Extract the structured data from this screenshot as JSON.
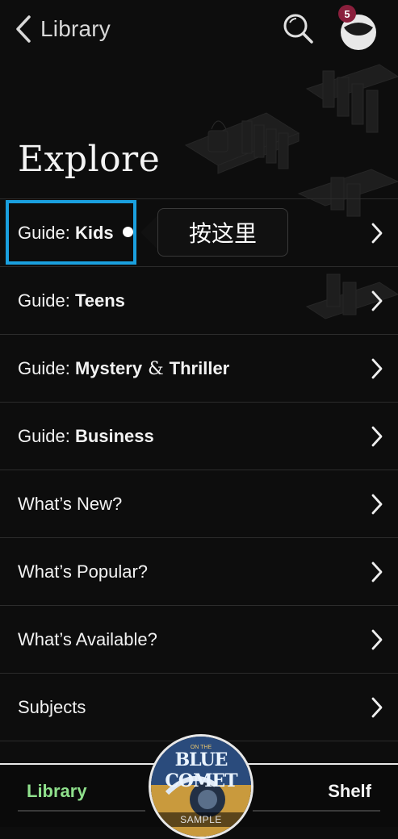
{
  "header": {
    "back_label": "Library",
    "notification_count": "5"
  },
  "page_title": "Explore",
  "menu": [
    {
      "prefix": "Guide: ",
      "bold": "Kids",
      "amp": "",
      "bold2": ""
    },
    {
      "prefix": "Guide: ",
      "bold": "Teens",
      "amp": "",
      "bold2": ""
    },
    {
      "prefix": "Guide: ",
      "bold": "Mystery",
      "amp": " & ",
      "bold2": "Thriller"
    },
    {
      "prefix": "Guide: ",
      "bold": "Business",
      "amp": "",
      "bold2": ""
    },
    {
      "prefix": "What’s New?",
      "bold": "",
      "amp": "",
      "bold2": ""
    },
    {
      "prefix": "What’s Popular?",
      "bold": "",
      "amp": "",
      "bold2": ""
    },
    {
      "prefix": "What’s Available?",
      "bold": "",
      "amp": "",
      "bold2": ""
    },
    {
      "prefix": "Subjects",
      "bold": "",
      "amp": "",
      "bold2": ""
    }
  ],
  "tooltip": {
    "text": "按这里"
  },
  "bottom_nav": {
    "library_label": "Library",
    "shelf_label": "Shelf",
    "book_sample_label": "SAMPLE",
    "book_cover_top": "ON THE",
    "book_cover_title": "BLUE COMET"
  },
  "colors": {
    "background": "#0d0d0d",
    "active_tab": "#8fe08c",
    "highlight_border": "#1aa0df",
    "badge": "#8a1f3c"
  },
  "icons": [
    "chevron-left-icon",
    "search-icon",
    "avatar-icon",
    "chevron-right-icon"
  ]
}
